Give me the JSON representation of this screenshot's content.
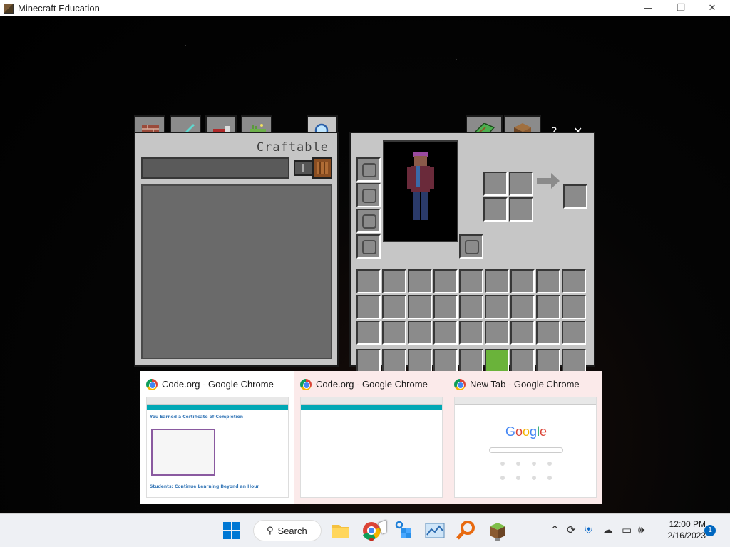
{
  "window": {
    "title": "Minecraft Education",
    "controls": {
      "minimize": "—",
      "maximize": "❐",
      "close": "✕"
    }
  },
  "recipe_book": {
    "tabs": [
      "construction",
      "equipment",
      "items",
      "nature",
      "search"
    ],
    "header": "Craftable",
    "search_placeholder": ""
  },
  "inventory": {
    "top_tabs": [
      "recipe-book",
      "crafting-table"
    ],
    "help_label": "?",
    "close_label": "✕",
    "armor_slots": [
      "helmet",
      "chestplate",
      "leggings",
      "boots"
    ],
    "offhand_slot": "shield",
    "selected_hotbar_slot": 6,
    "grid_rows": 4,
    "grid_cols": 9
  },
  "previews": [
    {
      "title": "Code.org - Google Chrome",
      "content": "certificate"
    },
    {
      "title": "Code.org - Google Chrome",
      "content": "blank"
    },
    {
      "title": "New Tab - Google Chrome",
      "content": "newtab"
    }
  ],
  "preview_text": {
    "cert_heading": "You Earned a Certificate of Completion",
    "cert_bottom": "Students: Continue Learning Beyond an Hour",
    "google_logo": "Google"
  },
  "taskbar": {
    "search_label": "Search",
    "apps": [
      "file-explorer",
      "google-chrome",
      "code-app",
      "stocks",
      "search-app",
      "minecraft-education"
    ]
  },
  "clock": {
    "time": "12:00 PM",
    "date": "2/16/2023"
  },
  "notifications": {
    "count": "1"
  },
  "colors": {
    "selected_slot": "#6ab33a",
    "panel": "#c6c6c6",
    "slot": "#8b8b8b"
  }
}
